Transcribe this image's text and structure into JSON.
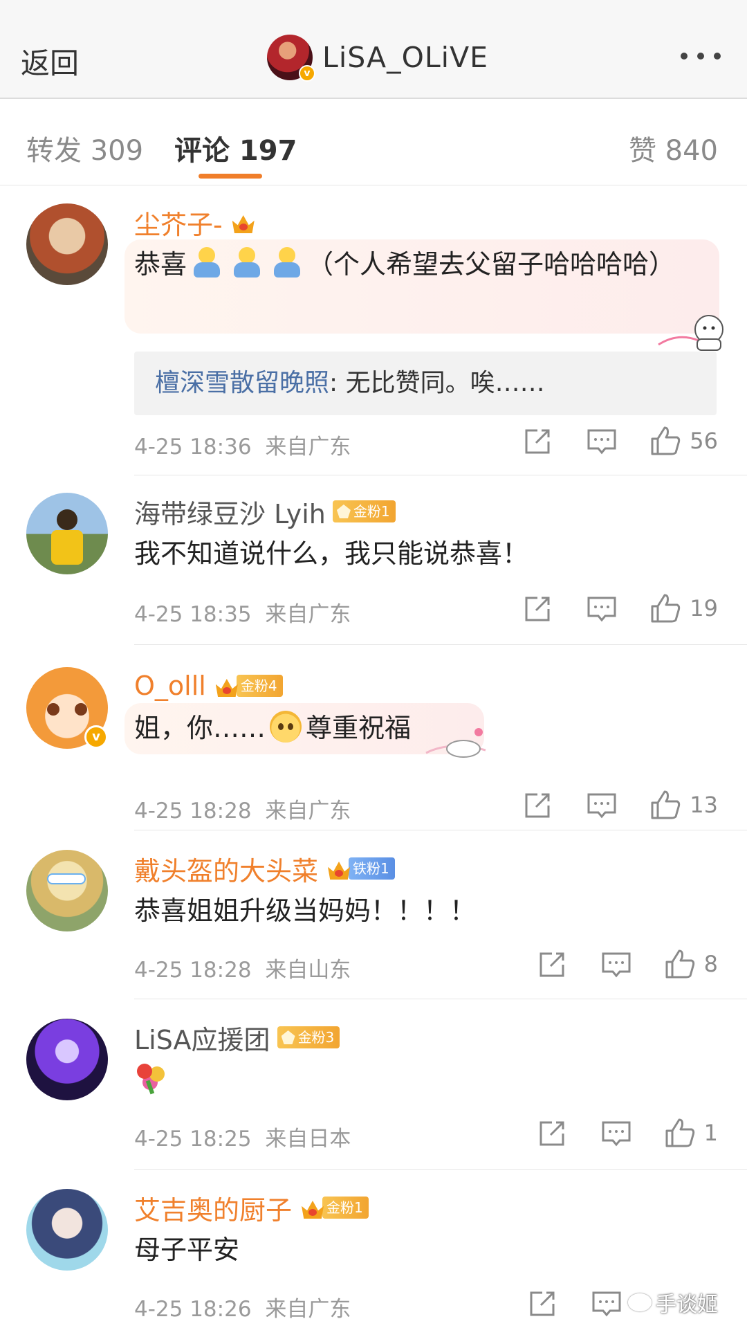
{
  "header": {
    "back_label": "返回",
    "title": "LiSA_OLiVE",
    "verified_mark": "v"
  },
  "tabs": {
    "repost": "转发 309",
    "comment": "评论 197",
    "like": "赞 840",
    "active_color": "#f07e2a"
  },
  "comments": [
    {
      "username": "尘芥子-",
      "text_before": "恭喜",
      "text_after": "（个人希望去父留子哈哈哈哈）",
      "reply": {
        "name": "檀深雪散留晚照",
        "text": ": 无比赞同。唉……"
      },
      "time": "4-25 18:36",
      "source": "来自广东",
      "likes": "56"
    },
    {
      "username": "海带绿豆沙 Lyih",
      "badge": "金粉1",
      "text": "我不知道说什么，我只能说恭喜！",
      "time": "4-25 18:35",
      "source": "来自广东",
      "likes": "19"
    },
    {
      "username": "O_olll",
      "badge": "金粉4",
      "verified_mark": "v",
      "text_before": "姐，你……",
      "text_after": "尊重祝福",
      "time": "4-25 18:28",
      "source": "来自广东",
      "likes": "13"
    },
    {
      "username": "戴头盔的大头菜",
      "badge": "铁粉1",
      "text": "恭喜姐姐升级当妈妈！！！！",
      "time": "4-25 18:28",
      "source": "来自山东",
      "likes": "8"
    },
    {
      "username": "LiSA应援团",
      "badge": "金粉3",
      "time": "4-25 18:25",
      "source": "来自日本",
      "likes": "1"
    },
    {
      "username": "艾吉奥的厨子",
      "badge": "金粉1",
      "text": "母子平安",
      "time": "4-25 18:26",
      "source": "来自广东"
    }
  ],
  "watermark": "手谈姬",
  "colors": {
    "orange_name": "#f0802c",
    "reply_name": "#4a6fa5",
    "gold_badge": "#f2a531",
    "iron_badge": "#5a8fe4"
  }
}
